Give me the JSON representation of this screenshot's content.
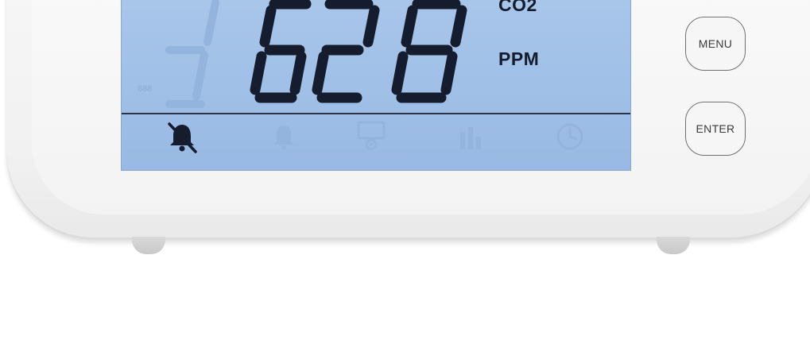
{
  "display": {
    "reading": "628",
    "gas_label": "CO2",
    "unit_label": "PPM",
    "ghost_indicator": "888"
  },
  "status_icons": [
    {
      "name": "alarm-muted-icon",
      "active": true
    },
    {
      "name": "alarm-icon",
      "active": false
    },
    {
      "name": "settings-screen-icon",
      "active": false
    },
    {
      "name": "bar-chart-icon",
      "active": false
    },
    {
      "name": "clock-icon",
      "active": false
    }
  ],
  "buttons": {
    "menu_label": "MENU",
    "enter_label": "ENTER"
  },
  "colors": {
    "lcd_background": "#a3c2e8",
    "lcd_segment_on": "#141c2e",
    "lcd_segment_off": "#93b4dc",
    "device_shell": "#f3f3f3",
    "button_border": "#6f6f6f"
  }
}
